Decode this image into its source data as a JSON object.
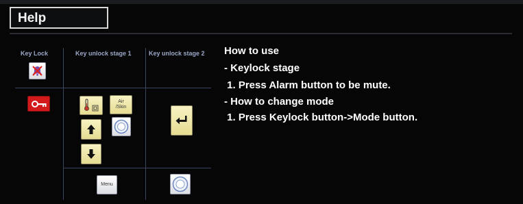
{
  "window": {
    "title": "Help"
  },
  "table": {
    "columns": [
      "Key Lock",
      "Key unlock stage 1",
      "Key unlock stage 2"
    ]
  },
  "buttons": {
    "air_skin_label": "Air\n/Skin",
    "menu_label": "Menu"
  },
  "help": {
    "lines": [
      "How to use",
      "- Keylock stage",
      " 1. Press Alarm button to be mute.",
      "- How to change mode",
      " 1. Press Keylock button->Mode button."
    ]
  },
  "colors": {
    "background": "#060607",
    "text": "#ffffff",
    "header_text": "#9aa8c8",
    "grid_line": "#3c4560",
    "keylock_red": "#d31a1a",
    "button_yellow": "#ede49f"
  },
  "icons": {
    "alarm_mute": "bell-crossed-icon",
    "keylock": "key-icon",
    "temperature": "thermometer-icon",
    "arrow_up": "arrow-up-icon",
    "arrow_down": "arrow-down-icon",
    "dial": "rotary-knob-icon",
    "enter": "enter-return-icon"
  }
}
